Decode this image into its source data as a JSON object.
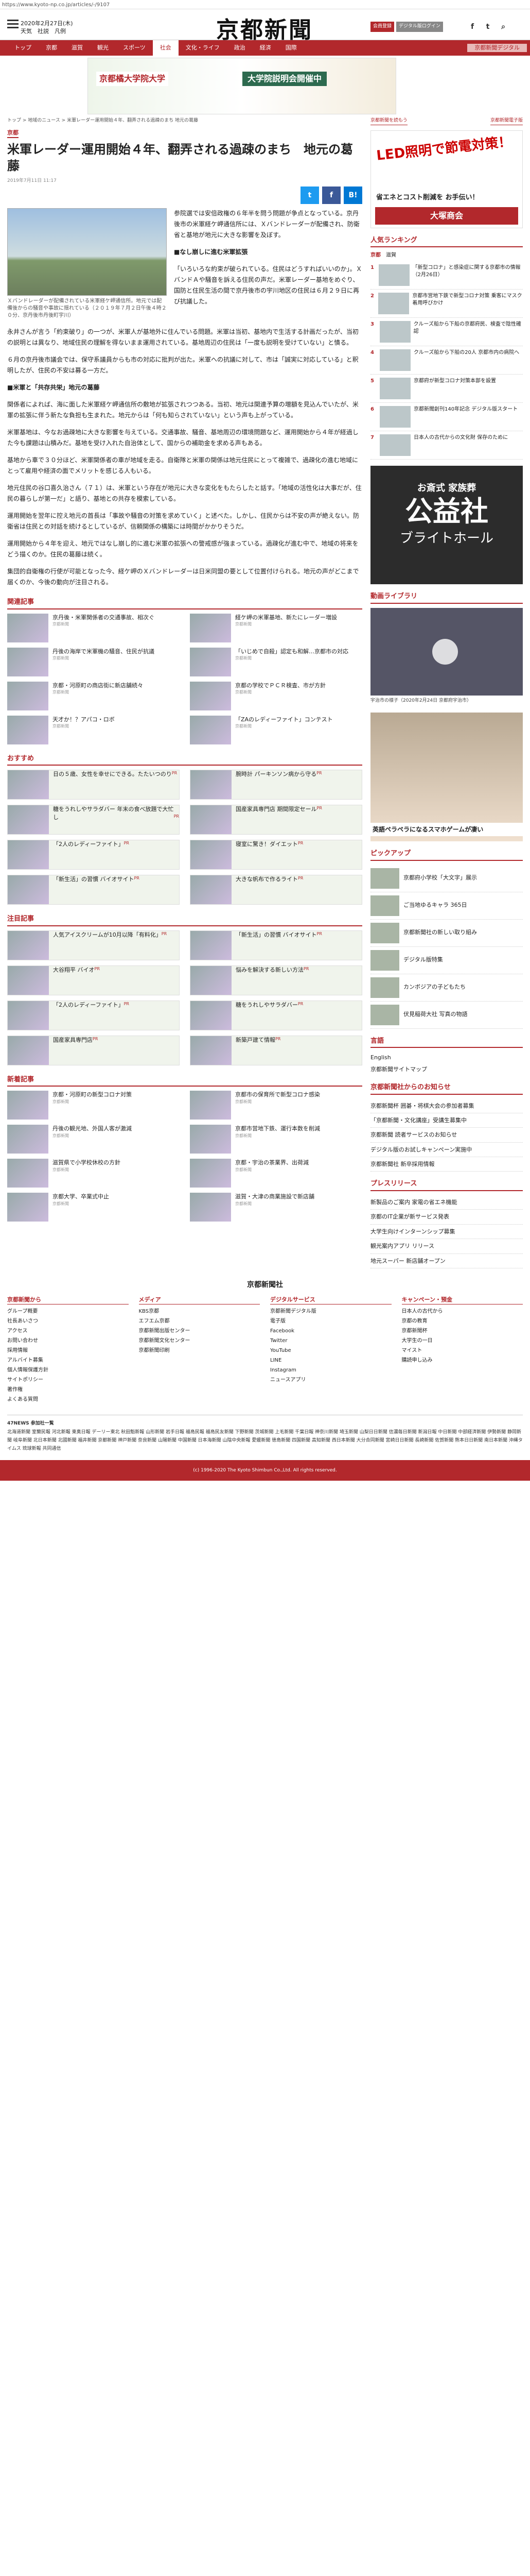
{
  "url": "https://www.kyoto-np.co.jp/articles/-/9107",
  "header": {
    "date": "2020年2月27日(木)",
    "links": "天気　社説　凡例",
    "logo": "京都新聞",
    "btn_login": "会員登録",
    "btn_e": "デジタル版ログイン"
  },
  "nav": [
    "トップ",
    "京都",
    "滋賀",
    "観光",
    "スポーツ",
    "社会",
    "文化・ライフ",
    "政治",
    "経済",
    "国際",
    "京都新聞デジタル"
  ],
  "banner": {
    "left": "京都橘大学院大学",
    "right": "大学院説明会開催中"
  },
  "breadcrumb": "トップ > 地域のニュース > 米軍レーダー運用開始４年、翻弄される過疎のまち 地元の葛藤",
  "category": "京都",
  "title": "米軍レーダー運用開始４年、翻弄される過疎のまち　地元の葛藤",
  "date": "2019年7月11日 11:17",
  "share": {
    "tw": "t",
    "fb": "f",
    "bi": "B!"
  },
  "photo_caption": "Ｘバンドレーダーが配備されている米軍経ケ岬通信所。地元では配備後からの騒音や事故に揺れている（２０１９年７月２日午後４時２０分、京丹後市丹後町宇川）",
  "lead": "参院選では安倍政権の６年半を問う問題が争点となっている。京丹後市の米軍経ケ岬通信所には、Ｘバンドレーダーが配備され、防衛省と基地が地元に大きな影響を及ぼす。",
  "sub1": "■なし崩しに進む米軍拡張",
  "body": [
    "「いろいろな約束が破られている。住民はどうすればいいのか」。ＸバンドＡや騒音を訴える住民の声だ。米軍レーダー基地をめぐり、国防と住民生活の間で京丹後市の宇川地区の住民は６月２９日に再び抗議した。",
    "永井さんが言う「約束破り」の一つが、米軍人が基地外に住んでいる問題。米軍は当初、基地内で生活する計画だったが、当初の説明とは異なり、地域住民の理解を得ないまま運用されている。基地周辺の住民は「一度も説明を受けていない」と憤る。",
    "６月の京丹後市議会では、保守系議員からも市の対応に批判が出た。米軍への抗議に対して、市は「誠実に対応している」と釈明したが、住民の不安は募る一方だ。",
    "■米軍と「共存共栄」地元の葛藤",
    "関係者によれば、海に面した米軍経ケ岬通信所の敷地が拡張されつつある。当初、地元は関連予算の増額を見込んでいたが、米軍の拡張に伴う新たな負担も生まれた。地元からは「何も知らされていない」という声も上がっている。",
    "米軍基地は、今なお過疎地に大きな影響を与えている。交通事故、騒音、基地周辺の環境問題など、運用開始から４年が経過した今も課題は山積みだ。基地を受け入れた自治体として、国からの補助金を求める声もある。",
    "基地から車で３０分ほど、米軍関係者の車が地域を走る。自衛隊と米軍の関係は地元住民にとって複雑で、過疎化の進む地域にとって雇用や経済の面でメリットを感じる人もいる。",
    "地元住民の谷口喜久治さん（７１）は、米軍という存在が地元に大きな変化をもたらしたと話す。「地域の活性化は大事だが、住民の暮らしが第一だ」と語り、基地との共存を模索している。",
    "運用開始を翌年に控え地元の首長は「事故や騒音の対策を求めていく」と述べた。しかし、住民からは不安の声が絶えない。防衛省は住民との対話を続けるとしているが、信頼関係の構築には時間がかかりそうだ。",
    "運用開始から４年を迎え、地元ではなし崩し的に進む米軍の拡張への警戒感が強まっている。過疎化が進む中で、地域の将来をどう描くのか。住民の葛藤は続く。",
    "集団的自衛権の行使が可能となった今、経ケ岬のＸバンドレーダーは日米同盟の要として位置付けられる。地元の声がどこまで届くのか、今後の動向が注目される。"
  ],
  "related_title": "関連記事",
  "related": [
    {
      "t": "京丹後・米軍関係者の交通事故、相次ぐ",
      "s": "京都新聞"
    },
    {
      "t": "経ケ岬の米軍基地、新たにレーダー増設",
      "s": "京都新聞"
    },
    {
      "t": "丹後の海岸で米軍機の騒音、住民が抗議",
      "s": "京都新聞"
    },
    {
      "t": "「いじめで自殺」認定も和解…京都市の対応",
      "s": "京都新聞"
    },
    {
      "t": "京都・河原町の商店街に新店舗続々",
      "s": "京都新聞"
    },
    {
      "t": "京都の学校でＰＣＲ検査、市が方針",
      "s": "京都新聞"
    },
    {
      "t": "天才か！？アパコ・ロボ",
      "s": "京都新聞"
    },
    {
      "t": "「ZAのレディーファイト」コンテスト",
      "s": "京都新聞"
    }
  ],
  "recommend_title": "おすすめ",
  "recommend": [
    {
      "t": "日の５歳、女性を幸せにできる。たたいつのり",
      "s": "PR"
    },
    {
      "t": "腕時計 パーキンソン病から守る",
      "s": "PR"
    },
    {
      "t": "糖をうれしやサラダバー 年末の食べ放題で大忙し",
      "s": "PR"
    },
    {
      "t": "国産家具専門店 期間限定セール",
      "s": "PR"
    },
    {
      "t": "「2人のレディーファイト」",
      "s": "PR"
    },
    {
      "t": "寝室に驚き！ダイエット",
      "s": "PR"
    },
    {
      "t": "「新生活」の習慣 バイオサイト",
      "s": "PR"
    },
    {
      "t": "大きな帆布で作るライト",
      "s": "PR"
    }
  ],
  "popular_title": "注目記事",
  "popular": [
    {
      "t": "人気アイスクリームが10月以降「有料化」",
      "s": "PR"
    },
    {
      "t": "「新生活」の習慣 バイオサイト",
      "s": "PR"
    },
    {
      "t": "大谷翔平 バイオ",
      "s": "PR"
    },
    {
      "t": "悩みを解決する新しい方法",
      "s": "PR"
    },
    {
      "t": "「2人のレディーファイト」",
      "s": "PR"
    },
    {
      "t": "糖をうれしやサラダバー",
      "s": "PR"
    },
    {
      "t": "国産家具専門店",
      "s": "PR"
    },
    {
      "t": "新築戸建て情報",
      "s": "PR"
    }
  ],
  "new_title": "新着記事",
  "newest": [
    {
      "t": "京都・河原町の新型コロナ対策",
      "s": "京都新聞"
    },
    {
      "t": "京都市の保育所で新型コロナ感染",
      "s": "京都新聞"
    },
    {
      "t": "丹後の観光地、外国人客が激減",
      "s": "京都新聞"
    },
    {
      "t": "京都市営地下鉄、運行本数を削減",
      "s": "京都新聞"
    },
    {
      "t": "滋賀県で小学校休校の方針",
      "s": "京都新聞"
    },
    {
      "t": "京都・宇治の茶業界、出荷減",
      "s": "京都新聞"
    },
    {
      "t": "京都大学、卒業式中止",
      "s": "京都新聞"
    },
    {
      "t": "滋賀・大津の商業施設で新店舗",
      "s": "京都新聞"
    }
  ],
  "side": {
    "links": [
      "京都新聞を読もう",
      "京都新聞電子版"
    ],
    "ad1_head": "LED照明で節電対策！",
    "ad1_sub": "省エネとコスト削減を お手伝い！",
    "ad1_bar": "大塚商会",
    "ranking_title": "人気ランキング",
    "rank_tabs": [
      "京都",
      "滋賀"
    ],
    "ranking": [
      {
        "n": "1",
        "t": "「新型コロナ」と感染症に関する京都市の情報（2月26日）"
      },
      {
        "n": "2",
        "t": "京都市営地下鉄で新型コロナ対策 乗客にマスク着用呼びかけ"
      },
      {
        "n": "3",
        "t": "クルーズ船から下船の京都府民、検査で陰性確認"
      },
      {
        "n": "4",
        "t": "クルーズ船から下船の20人 京都市内の病院へ"
      },
      {
        "n": "5",
        "t": "京都府が新型コロナ対策本部を設置"
      },
      {
        "n": "6",
        "t": "京都新聞創刊140年記念 デジタル版スタート"
      },
      {
        "n": "7",
        "t": "日本人の古代からの文化財 保存のために"
      }
    ],
    "ad2_a": "お斎式 家族葬",
    "ad2_b": "公益社",
    "ad2_c": "ブライトホール",
    "video_title": "動画ライブラリ",
    "video_cap": "宇治市の様子（2020年2月24日 京都府宇治市）",
    "ad3_text": "英語ペラペラになるスマホゲームが凄い",
    "pickup_title": "ピックアップ",
    "pickup": [
      "京都府小学校「大文字」展示",
      "ご当地ゆるキャラ 365日",
      "京都新聞社の新しい取り組み",
      "デジタル版特集",
      "カンボジアの子どもたち",
      "伏見稲荷大社 写真の物語"
    ],
    "lang_title": "言語",
    "lang": [
      "English",
      "京都新聞サイトマップ"
    ],
    "notice_title": "京都新聞社からのお知らせ",
    "notices": [
      "京都新聞杯 囲碁・将棋大会の参加者募集",
      "「京都新聞・文化講座」受講生募集中",
      "京都新聞 読者サービスのお知らせ",
      "デジタル版のお試しキャンペーン実施中",
      "京都新聞社 新卒採用情報"
    ],
    "press_title": "プレスリリース",
    "press": [
      "新製品のご案内 家電の省エネ機能",
      "京都のIT企業が新サービス発表",
      "大学生向けインターンシップ募集",
      "観光案内アプリ リリース",
      "地元スーパー 新店舗オープン"
    ]
  },
  "footer_logo": "京都新聞社",
  "footer": [
    {
      "h": "京都新聞から",
      "items": [
        "グループ概要",
        "社長あいさつ",
        "アクセス",
        "お問い合わせ",
        "採用情報",
        "アルバイト募集",
        "個人情報保護方針",
        "サイトポリシー",
        "著作権",
        "よくある質問"
      ]
    },
    {
      "h": "メディア",
      "items": [
        "KBS京都",
        "エフエム京都",
        "京都新聞出版センター",
        "京都新聞文化センター",
        "京都新聞印刷"
      ]
    },
    {
      "h": "デジタルサービス",
      "items": [
        "京都新聞デジタル版",
        "電子版",
        "Facebook",
        "Twitter",
        "YouTube",
        "LINE",
        "Instagram",
        "ニュースアプリ"
      ]
    },
    {
      "h": "キャンペーン・預金",
      "items": [
        "日本人の古代から",
        "京都の教育",
        "京都新聞杯",
        "大学生の一日",
        "マイスト",
        "購読申し込み"
      ]
    }
  ],
  "kn_title": "47NEWS 参加社一覧",
  "kn_text": "北海道新聞 室蘭民報 河北新報 東奥日報 デーリー東北 秋田魁新報 山形新聞 岩手日報 福島民報 福島民友新聞 下野新聞 茨城新聞 上毛新聞 千葉日報 神奈川新聞 埼玉新聞 山梨日日新聞 信濃毎日新聞 新潟日報 中日新聞 中部経済新聞 伊勢新聞 静岡新聞 岐阜新聞 北日本新聞 北國新聞 福井新聞 京都新聞 神戸新聞 奈良新聞 山陽新聞 中国新聞 日本海新聞 山陰中央新報 愛媛新聞 徳島新聞 四国新聞 高知新聞 西日本新聞 大分合同新聞 宮崎日日新聞 長崎新聞 佐賀新聞 熊本日日新聞 南日本新聞 沖縄タイムス 琉球新報 共同通信",
  "copyright": "(c) 1996-2020 The Kyoto Shimbun Co.,Ltd. All rights reserved."
}
